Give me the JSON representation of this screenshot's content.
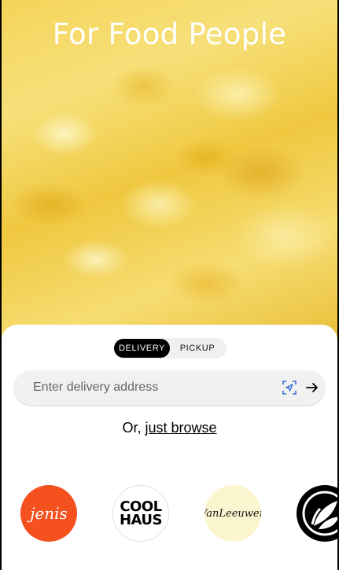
{
  "hero": {
    "title": "For Food People"
  },
  "mode_toggle": {
    "options": [
      {
        "label": "DELIVERY",
        "active": true
      },
      {
        "label": "PICKUP",
        "active": false
      }
    ]
  },
  "address": {
    "placeholder": "Enter delivery address",
    "value": "",
    "icons": [
      "location-target-icon",
      "arrow-right-icon"
    ]
  },
  "browse": {
    "prefix": "Or,",
    "link": "just browse"
  },
  "brands": [
    {
      "name": "jenis",
      "text": "jenis",
      "color": "#f4511e"
    },
    {
      "name": "coolhaus",
      "text_line1": "COOL",
      "text_line2": "HAUS",
      "color": "#ffffff"
    },
    {
      "name": "vanleeuwen",
      "text": "VanLeeuwen",
      "color": "#fbf6cf"
    },
    {
      "name": "leaf-brand",
      "color": "#000000"
    }
  ],
  "colors": {
    "accent": "#000000",
    "sheet": "#ffffff",
    "input_bg": "#f1f1f1",
    "location_icon": "#2f6fd6"
  }
}
